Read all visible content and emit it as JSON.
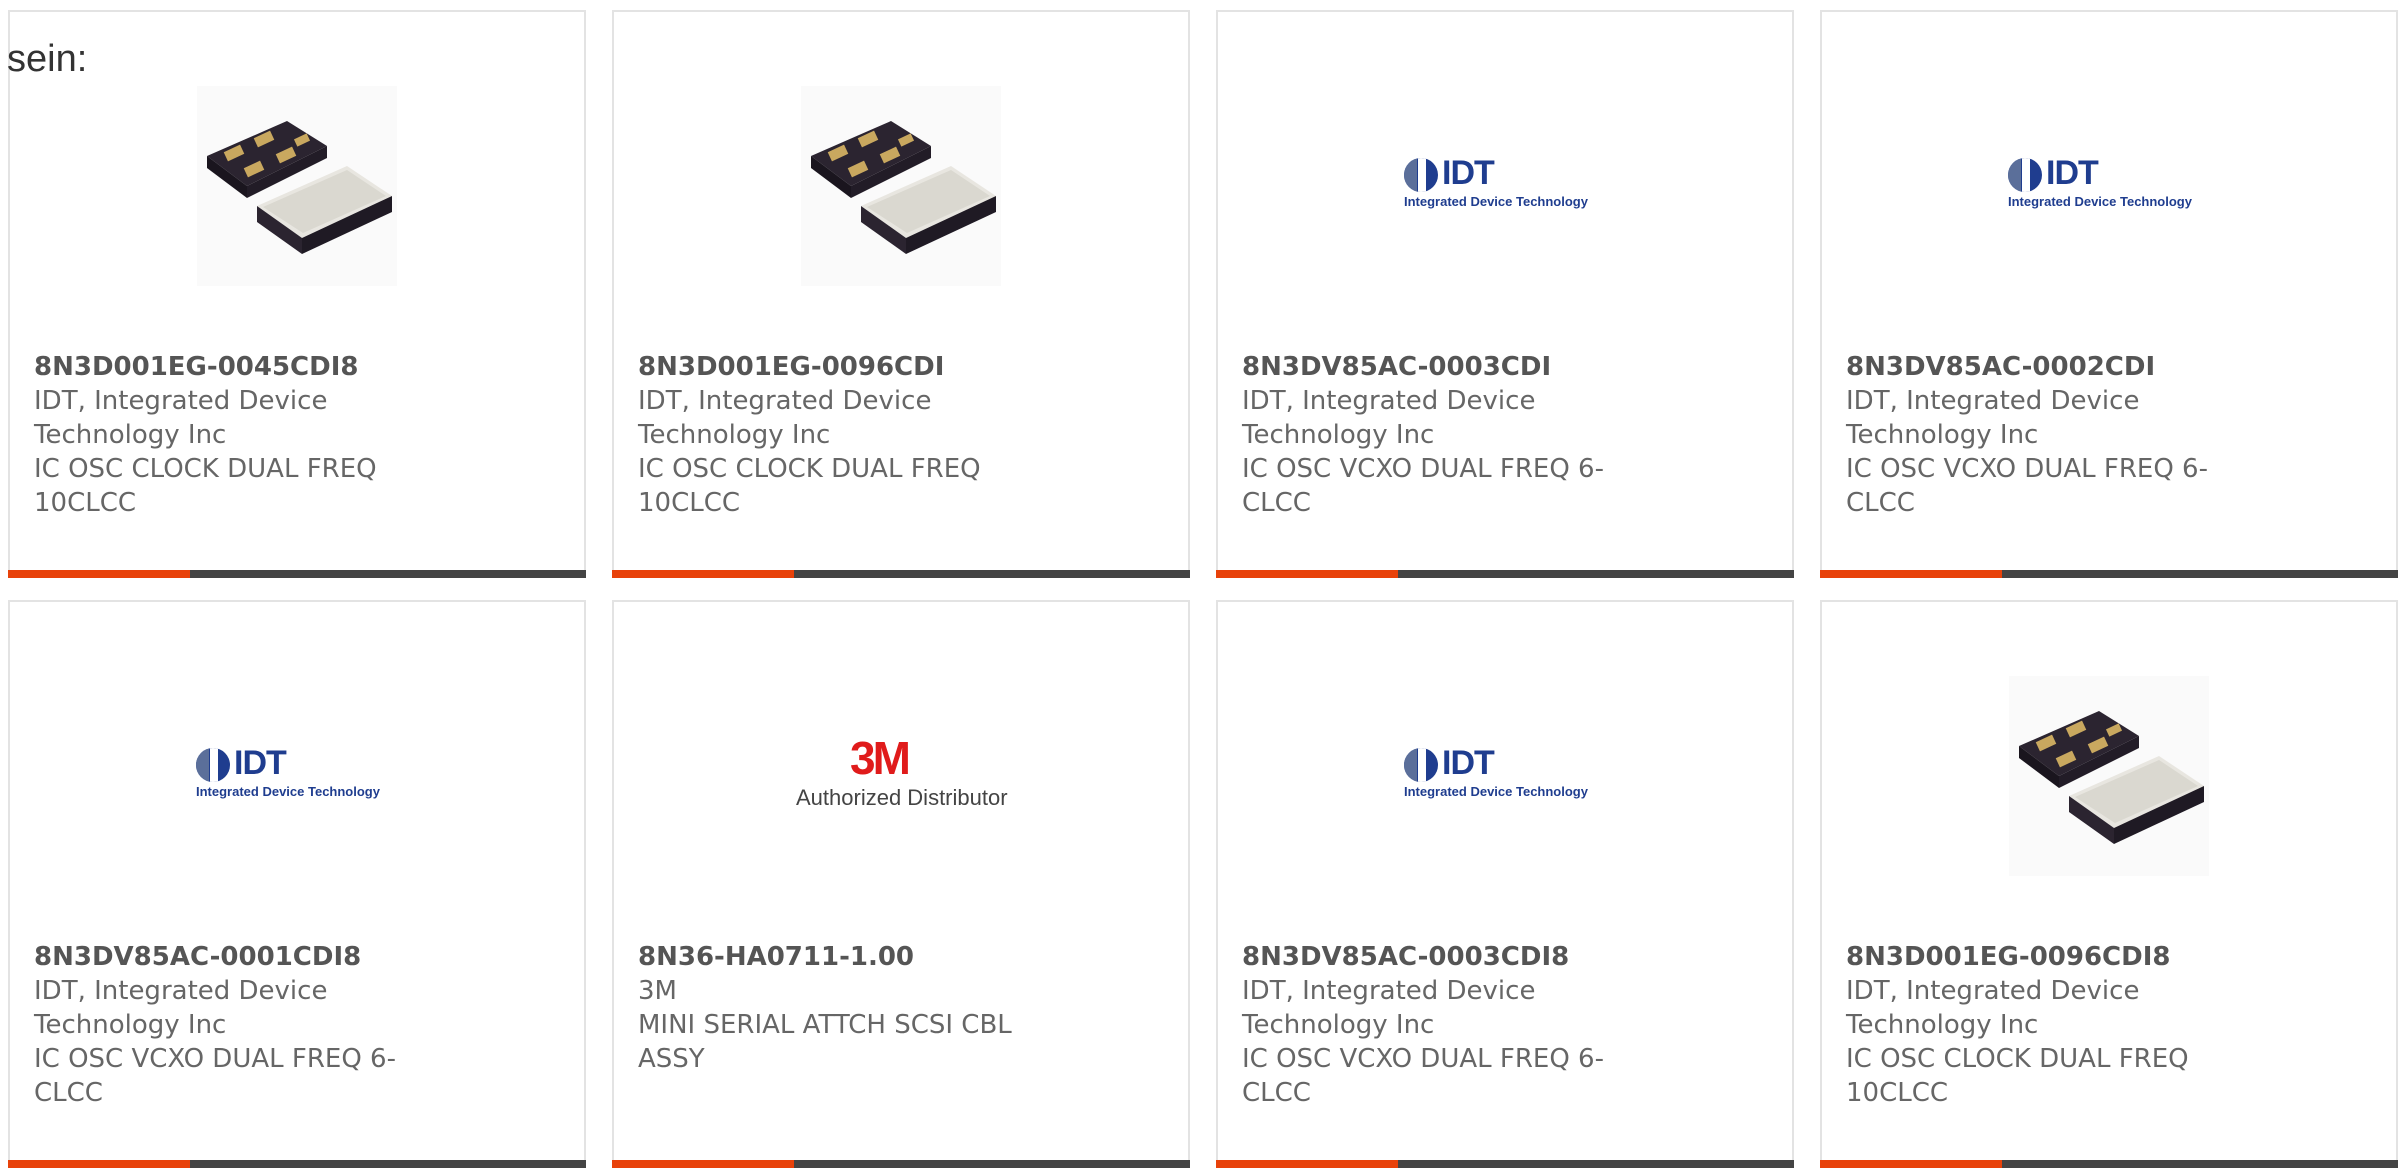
{
  "intro_text": "sein:",
  "products": [
    {
      "part_number": "8N3D001EG-0045CDI8",
      "manufacturer": "IDT, Integrated Device Technology Inc",
      "description": "IC OSC CLOCK DUAL FREQ 10CLCC",
      "image": "chip-package-photo"
    },
    {
      "part_number": "8N3D001EG-0096CDI",
      "manufacturer": "IDT, Integrated Device Technology Inc",
      "description": "IC OSC CLOCK DUAL FREQ 10CLCC",
      "image": "chip-package-photo"
    },
    {
      "part_number": "8N3DV85AC-0003CDI",
      "manufacturer": "IDT, Integrated Device Technology Inc",
      "description": "IC OSC VCXO DUAL FREQ 6-CLCC",
      "image": "idt-logo",
      "logo_word": "IDT",
      "logo_tagline": "Integrated Device Technology"
    },
    {
      "part_number": "8N3DV85AC-0002CDI",
      "manufacturer": "IDT, Integrated Device Technology Inc",
      "description": "IC OSC VCXO DUAL FREQ 6-CLCC",
      "image": "idt-logo",
      "logo_word": "IDT",
      "logo_tagline": "Integrated Device Technology"
    },
    {
      "part_number": "8N3DV85AC-0001CDI8",
      "manufacturer": "IDT, Integrated Device Technology Inc",
      "description": "IC OSC VCXO DUAL FREQ 6-CLCC",
      "image": "idt-logo",
      "logo_word": "IDT",
      "logo_tagline": "Integrated Device Technology"
    },
    {
      "part_number": "8N36-HA0711-1.00",
      "manufacturer": "3M",
      "description": "MINI SERIAL ATTCH SCSI CBL ASSY",
      "image": "3m-logo",
      "logo_word": "3M",
      "logo_tagline": "Authorized Distributor"
    },
    {
      "part_number": "8N3DV85AC-0003CDI8",
      "manufacturer": "IDT, Integrated Device Technology Inc",
      "description": "IC OSC VCXO DUAL FREQ 6-CLCC",
      "image": "idt-logo",
      "logo_word": "IDT",
      "logo_tagline": "Integrated Device Technology"
    },
    {
      "part_number": "8N3D001EG-0096CDI8",
      "manufacturer": "IDT, Integrated Device Technology Inc",
      "description": "IC OSC CLOCK DUAL FREQ 10CLCC",
      "image": "chip-package-photo"
    }
  ],
  "colors": {
    "accent": "#e8420a",
    "bar": "#444444",
    "card_border": "#e3e3e3",
    "idt_blue": "#1f3d8f",
    "mmm_red": "#e01b1b"
  }
}
